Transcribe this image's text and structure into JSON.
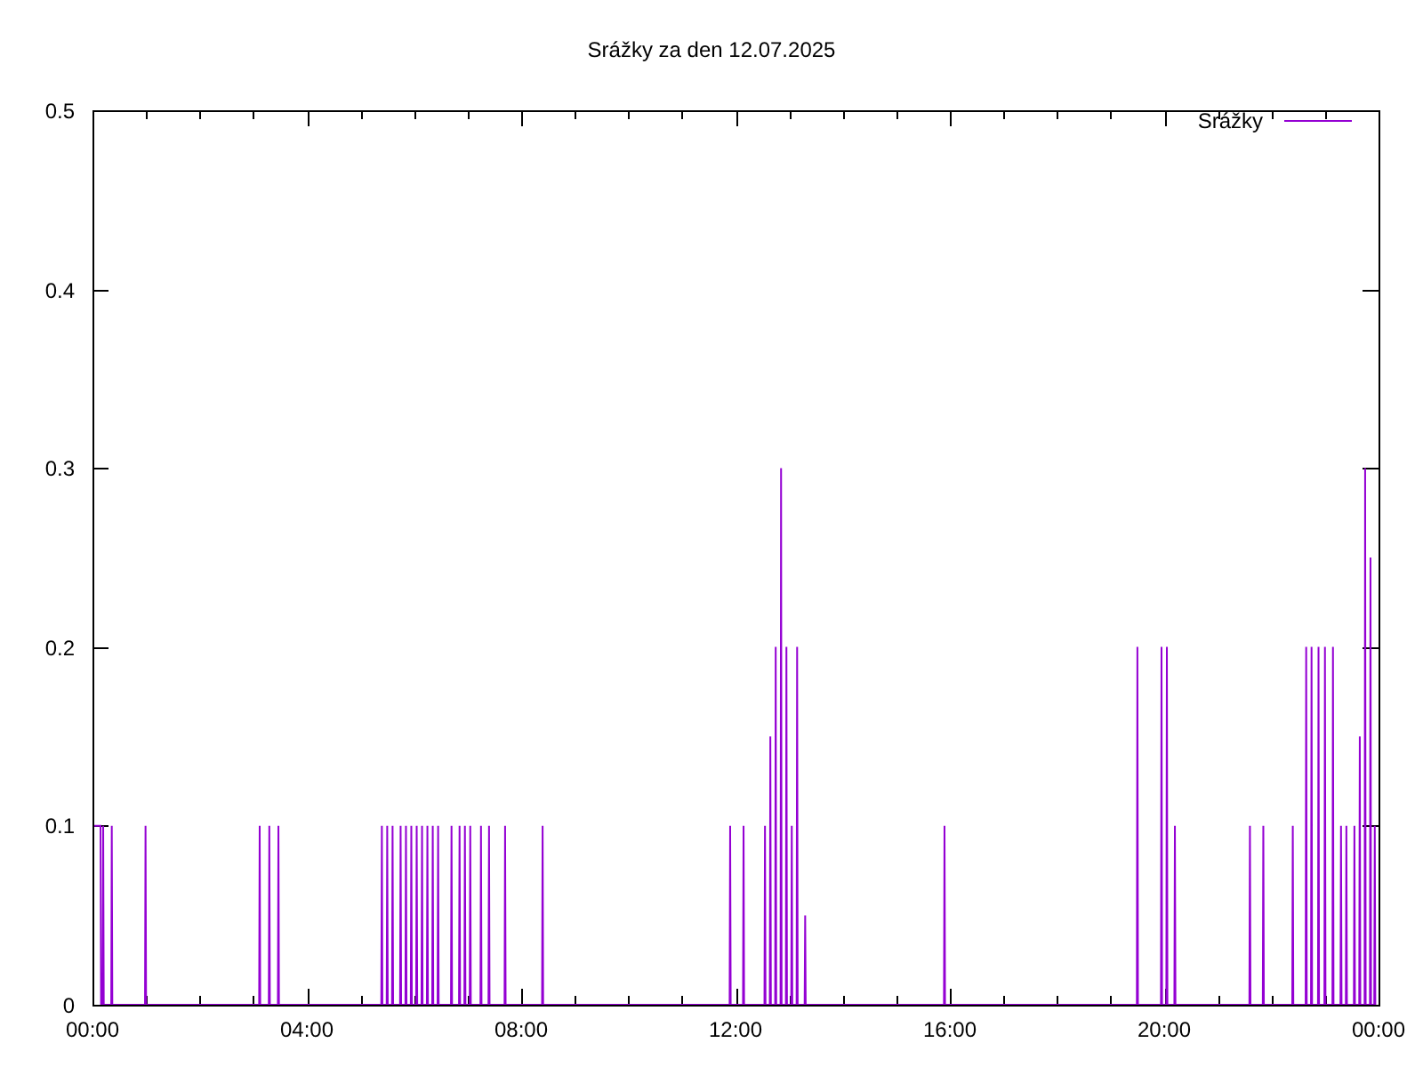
{
  "chart": {
    "chart_data": {
      "type": "line",
      "title": "Srážky za den 12.07.2025",
      "x": [
        0,
        0.15,
        0.16,
        0.19,
        0.2,
        0.21,
        0.35,
        0.36,
        0.37,
        0.98,
        0.99,
        1.0,
        3.11,
        3.12,
        3.13,
        3.29,
        3.3,
        3.31,
        3.46,
        3.47,
        3.48,
        5.39,
        5.4,
        5.41,
        5.49,
        5.5,
        5.51,
        5.59,
        5.6,
        5.61,
        5.74,
        5.75,
        5.76,
        5.84,
        5.85,
        5.86,
        5.94,
        5.95,
        5.96,
        6.04,
        6.05,
        6.06,
        6.14,
        6.15,
        6.16,
        6.24,
        6.25,
        6.26,
        6.34,
        6.35,
        6.36,
        6.44,
        6.45,
        6.46,
        6.69,
        6.7,
        6.71,
        6.84,
        6.85,
        6.86,
        6.94,
        6.95,
        6.96,
        7.04,
        7.05,
        7.06,
        7.24,
        7.25,
        7.26,
        7.39,
        7.4,
        7.41,
        7.69,
        7.7,
        7.71,
        8.39,
        8.4,
        8.41,
        11.89,
        11.9,
        11.91,
        12.14,
        12.15,
        12.16,
        12.54,
        12.55,
        12.56,
        12.64,
        12.65,
        12.66,
        12.74,
        12.75,
        12.76,
        12.84,
        12.85,
        12.86,
        12.94,
        12.95,
        12.96,
        13.04,
        13.05,
        13.06,
        13.14,
        13.15,
        13.16,
        13.29,
        13.3,
        13.31,
        15.89,
        15.9,
        15.91,
        19.49,
        19.5,
        19.51,
        19.94,
        19.95,
        19.96,
        20.04,
        20.05,
        20.06,
        20.19,
        20.2,
        20.21,
        21.59,
        21.6,
        21.61,
        21.84,
        21.85,
        21.86,
        22.39,
        22.4,
        22.41,
        22.64,
        22.65,
        22.66,
        22.74,
        22.75,
        22.76,
        22.87,
        22.88,
        22.89,
        22.99,
        23.0,
        23.01,
        23.14,
        23.15,
        23.16,
        23.29,
        23.3,
        23.31,
        23.39,
        23.4,
        23.41,
        23.54,
        23.55,
        23.56,
        23.64,
        23.65,
        23.66,
        23.74,
        23.75,
        23.76,
        23.84,
        23.85,
        23.86,
        23.92,
        23.93,
        23.94
      ],
      "series": [
        {
          "name": "Srážky",
          "color": "#9400d3",
          "values": [
            0.1,
            0.1,
            0,
            0,
            0.1,
            0,
            0,
            0.1,
            0,
            0,
            0.1,
            0,
            0,
            0.1,
            0,
            0,
            0.1,
            0,
            0,
            0.1,
            0,
            0,
            0.1,
            0,
            0,
            0.1,
            0,
            0,
            0.1,
            0,
            0,
            0.1,
            0,
            0,
            0.1,
            0,
            0,
            0.1,
            0,
            0,
            0.1,
            0,
            0,
            0.1,
            0,
            0,
            0.1,
            0,
            0,
            0.1,
            0,
            0,
            0.1,
            0,
            0,
            0.1,
            0,
            0,
            0.1,
            0,
            0,
            0.1,
            0,
            0,
            0.1,
            0,
            0,
            0.1,
            0,
            0,
            0.1,
            0,
            0,
            0.1,
            0,
            0,
            0.1,
            0,
            0,
            0.1,
            0,
            0,
            0.1,
            0,
            0,
            0.1,
            0,
            0,
            0.15,
            0,
            0,
            0.2,
            0,
            0,
            0.3,
            0,
            0,
            0.2,
            0,
            0,
            0.1,
            0,
            0,
            0.2,
            0,
            0,
            0.05,
            0,
            0,
            0.1,
            0,
            0,
            0.2,
            0,
            0,
            0.2,
            0,
            0,
            0.2,
            0,
            0,
            0.1,
            0,
            0,
            0.1,
            0,
            0,
            0.1,
            0,
            0,
            0.1,
            0,
            0,
            0.2,
            0,
            0,
            0.2,
            0,
            0,
            0.2,
            0,
            0,
            0.2,
            0,
            0,
            0.2,
            0,
            0,
            0.1,
            0,
            0,
            0.1,
            0,
            0,
            0.1,
            0,
            0,
            0.15,
            0,
            0,
            0.3,
            0,
            0,
            0.25,
            0,
            0,
            0.1,
            0
          ]
        }
      ],
      "xlim": [
        0,
        24
      ],
      "ylim": [
        0,
        0.5
      ],
      "xticks": [
        {
          "value": 0,
          "label": "00:00"
        },
        {
          "value": 4,
          "label": "04:00"
        },
        {
          "value": 8,
          "label": "08:00"
        },
        {
          "value": 12,
          "label": "12:00"
        },
        {
          "value": 16,
          "label": "16:00"
        },
        {
          "value": 20,
          "label": "20:00"
        },
        {
          "value": 24,
          "label": "00:00"
        }
      ],
      "yticks": [
        {
          "value": 0,
          "label": "0"
        },
        {
          "value": 0.1,
          "label": "0.1"
        },
        {
          "value": 0.2,
          "label": "0.2"
        },
        {
          "value": 0.3,
          "label": "0.3"
        },
        {
          "value": 0.4,
          "label": "0.4"
        },
        {
          "value": 0.5,
          "label": "0.5"
        }
      ]
    }
  }
}
